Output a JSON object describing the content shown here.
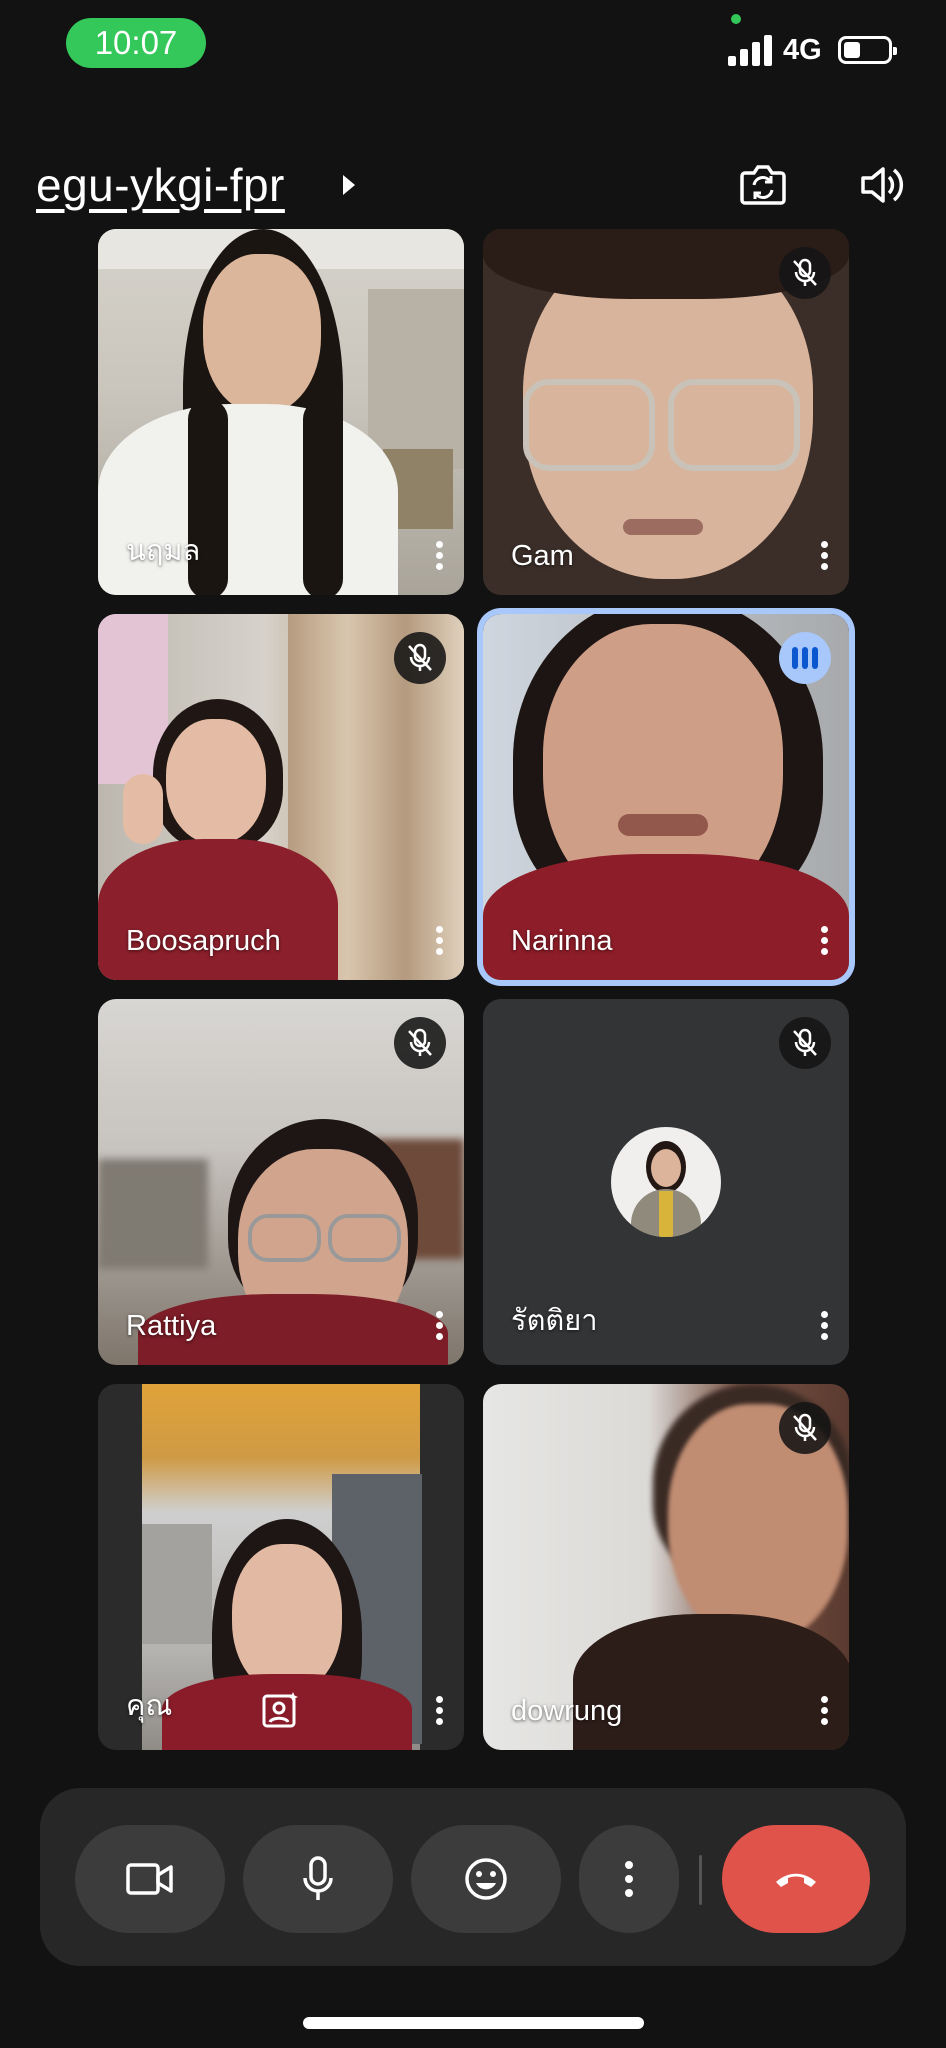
{
  "status_bar": {
    "time": "10:07",
    "network": "4G"
  },
  "header": {
    "meeting_code": "egu-ykgi-fpr",
    "switch_camera_icon": "camera-switch-icon",
    "speaker_icon": "volume-icon"
  },
  "tiles": [
    {
      "name": "นฤมล",
      "muted": false,
      "speaking": false
    },
    {
      "name": "Gam",
      "muted": true,
      "speaking": false
    },
    {
      "name": "Boosapruch",
      "muted": true,
      "speaking": false
    },
    {
      "name": "Narinna",
      "muted": false,
      "speaking": true
    },
    {
      "name": "Rattiya",
      "muted": true,
      "speaking": false
    },
    {
      "name": "รัตติยา",
      "muted": true,
      "speaking": false,
      "camera_off": true
    },
    {
      "name": "คุณ",
      "muted": false,
      "speaking": false,
      "self": true
    },
    {
      "name": "dowrung",
      "muted": true,
      "speaking": false
    }
  ],
  "controls": {
    "camera": "video-camera-icon",
    "microphone": "microphone-icon",
    "reactions": "emoji-icon",
    "more": "more-vertical-icon",
    "end_call": "hang-up-icon"
  },
  "colors": {
    "status_time_bg": "#34c759",
    "active_speaker_border": "#a8c7fa",
    "end_call": "#e0534a",
    "background": "#121212"
  }
}
